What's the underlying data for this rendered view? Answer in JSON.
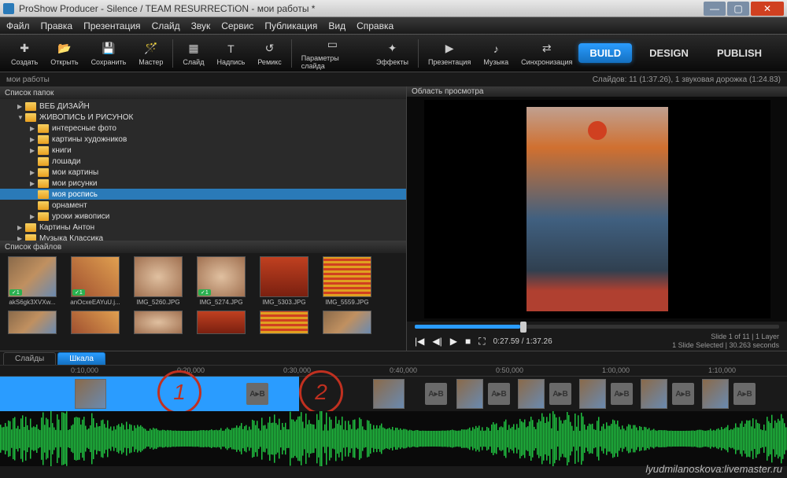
{
  "window": {
    "title": "ProShow Producer - Silence / TEAM RESURRECTiON - мои работы *"
  },
  "menu": [
    "Файл",
    "Правка",
    "Презентация",
    "Слайд",
    "Звук",
    "Сервис",
    "Публикация",
    "Вид",
    "Справка"
  ],
  "toolbar": [
    {
      "label": "Создать",
      "icon": "✚"
    },
    {
      "label": "Открыть",
      "icon": "📂"
    },
    {
      "label": "Сохранить",
      "icon": "💾"
    },
    {
      "label": "Мастер",
      "icon": "🪄"
    },
    {
      "label": "Слайд",
      "icon": "▦"
    },
    {
      "label": "Надпись",
      "icon": "Т"
    },
    {
      "label": "Ремикс",
      "icon": "↺"
    },
    {
      "label": "Параметры слайда",
      "icon": "▭"
    },
    {
      "label": "Эффекты",
      "icon": "✦"
    },
    {
      "label": "Презентация",
      "icon": "▶"
    },
    {
      "label": "Музыка",
      "icon": "♪"
    },
    {
      "label": "Синхронизация",
      "icon": "⇄"
    }
  ],
  "modes": {
    "build": "BUILD",
    "design": "DESIGN",
    "publish": "PUBLISH"
  },
  "statusbar": {
    "project": "мои работы",
    "info": "Слайдов: 11 (1:37.26), 1 звуковая дорожка (1:24.83)"
  },
  "tree": {
    "header": "Список папок",
    "items": [
      {
        "label": "ВЕБ ДИЗАЙН",
        "level": 1,
        "arrow": "▶",
        "sel": false
      },
      {
        "label": "ЖИВОПИСЬ И РИСУНОК",
        "level": 1,
        "arrow": "▼",
        "sel": false
      },
      {
        "label": "интересные фото",
        "level": 2,
        "arrow": "▶",
        "sel": false
      },
      {
        "label": "картины художников",
        "level": 2,
        "arrow": "▶",
        "sel": false
      },
      {
        "label": "книги",
        "level": 2,
        "arrow": "▶",
        "sel": false
      },
      {
        "label": "лошади",
        "level": 2,
        "arrow": "",
        "sel": false
      },
      {
        "label": "мои картины",
        "level": 2,
        "arrow": "▶",
        "sel": false
      },
      {
        "label": "мои рисунки",
        "level": 2,
        "arrow": "▶",
        "sel": false
      },
      {
        "label": "моя роспись",
        "level": 2,
        "arrow": "",
        "sel": true
      },
      {
        "label": "орнамент",
        "level": 2,
        "arrow": "",
        "sel": false
      },
      {
        "label": "уроки живописи",
        "level": 2,
        "arrow": "▶",
        "sel": false
      },
      {
        "label": "Картины Антон",
        "level": 1,
        "arrow": "▶",
        "sel": false
      },
      {
        "label": "Музыка Классика",
        "level": 1,
        "arrow": "▶",
        "sel": false
      }
    ]
  },
  "files": {
    "header": "Список файлов",
    "items": [
      {
        "name": "akS6gk3XVXw...",
        "badge": "✓1",
        "t": "t1"
      },
      {
        "name": "anOcxeEAYuU.j...",
        "badge": "✓1",
        "t": "t2"
      },
      {
        "name": "IMG_5260.JPG",
        "badge": "",
        "t": "t3"
      },
      {
        "name": "IMG_5274.JPG",
        "badge": "✓1",
        "t": "t3"
      },
      {
        "name": "IMG_5303.JPG",
        "badge": "",
        "t": "t4"
      },
      {
        "name": "IMG_5559.JPG",
        "badge": "",
        "t": "t5"
      }
    ]
  },
  "preview": {
    "header": "Область просмотра",
    "time": "0:27.59 / 1:37.26",
    "slideinfo": "Slide 1 of 11  |  1 Layer",
    "selinfo": "1 Slide Selected  |  30.263 seconds"
  },
  "timeline": {
    "tabs": {
      "slides": "Слайды",
      "scale": "Шкала"
    },
    "ruler": [
      "0:10,000",
      "0:20,000",
      "0:30,000",
      "0:40,000",
      "0:50,000",
      "1:00,000",
      "1:10,000"
    ],
    "annotations": {
      "one": "1",
      "two": "2"
    }
  },
  "watermark": "lyudmilanoskova:livemaster.ru"
}
